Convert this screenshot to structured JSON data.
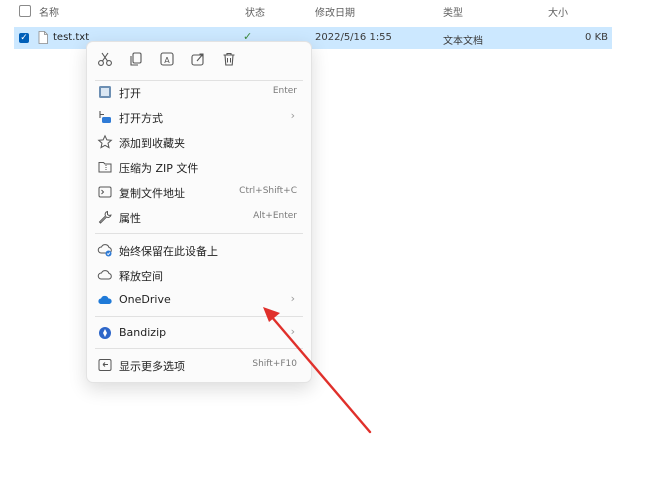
{
  "header": {
    "name": "名称",
    "status": "状态",
    "modified": "修改日期",
    "type": "类型",
    "size": "大小"
  },
  "file": {
    "name": "test.txt",
    "modified": "2022/5/16 1:55",
    "type": "文本文档",
    "size": "0 KB"
  },
  "toolbar": {
    "icons": [
      "scissors-icon",
      "copy-icon",
      "rename-icon",
      "share-icon",
      "trash-icon"
    ]
  },
  "menu": {
    "open": "打开",
    "open_shortcut": "Enter",
    "open_with": "打开方式",
    "add_favorites": "添加到收藏夹",
    "compress_zip": "压缩为 ZIP 文件",
    "copy_path": "复制文件地址",
    "copy_path_shortcut": "Ctrl+Shift+C",
    "properties": "属性",
    "properties_shortcut": "Alt+Enter",
    "always_keep": "始终保留在此设备上",
    "free_space": "释放空间",
    "onedrive": "OneDrive",
    "bandizip": "Bandizip",
    "more_options": "显示更多选项",
    "more_options_shortcut": "Shift+F10"
  },
  "colors": {
    "selection": "#cce8ff",
    "accent": "#005fb8",
    "arrow": "#e0302b"
  }
}
